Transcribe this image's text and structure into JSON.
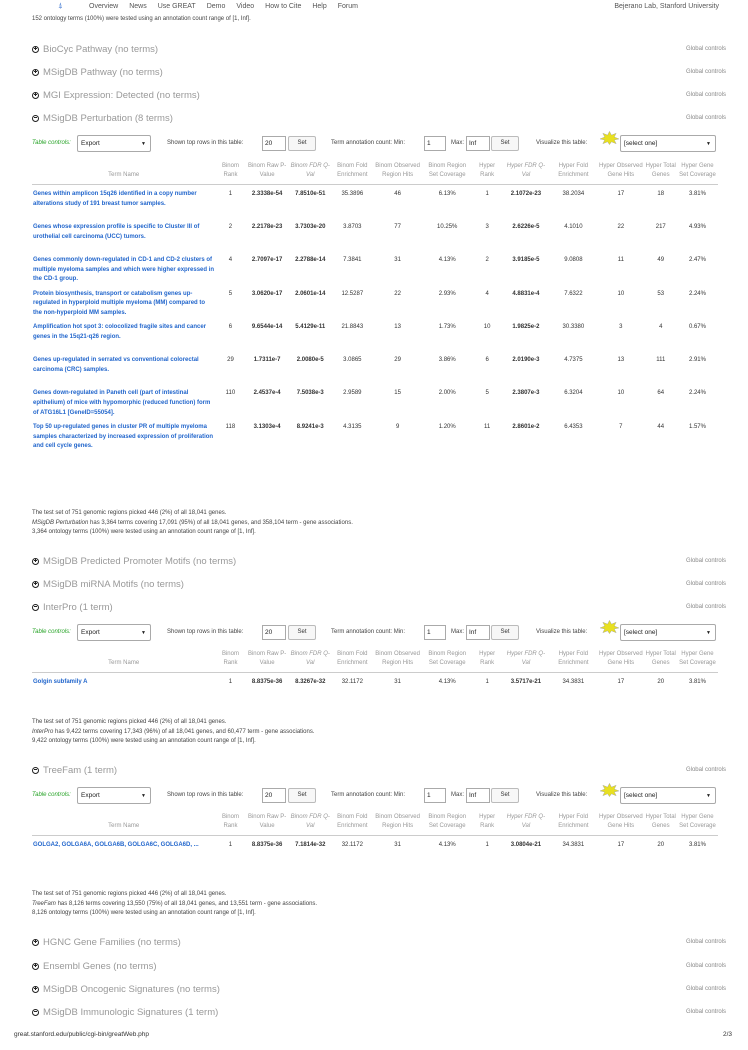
{
  "nav": {
    "logo": "⍋",
    "items": [
      "Overview",
      "News",
      "Use GREAT",
      "Demo",
      "Video",
      "How to Cite",
      "Help",
      "Forum"
    ],
    "lab": "Bejerano Lab, Stanford University"
  },
  "top_line": "152 ontology terms (100%) were tested using an annotation count range of [1, Inf].",
  "global_controls": "Global controls",
  "collapsed_sections": {
    "biocyc": "BioCyc Pathway (no terms)",
    "msigdb_pathway": "MSigDB Pathway (no terms)",
    "mgi": "MGI Expression: Detected (no terms)",
    "promoter": "MSigDB Predicted Promoter Motifs (no terms)",
    "mirna": "MSigDB miRNA Motifs (no terms)",
    "hgnc": "HGNC Gene Families (no terms)",
    "ensembl": "Ensembl Genes (no terms)",
    "oncogenic": "MSigDB Oncogenic Signatures (no terms)",
    "immunologic": "MSigDB Immunologic Signatures (1 term)"
  },
  "controls": {
    "table_controls": "Table controls:",
    "export": "Export",
    "shown_top": "Shown top rows in this table:",
    "top_value": "20",
    "set": "Set",
    "term_annot": "Term annotation count: Min:",
    "min_value": "1",
    "max": "Max:",
    "max_value": "Inf",
    "visualize": "Visualize this table:",
    "select_one": "[select one]"
  },
  "headers": {
    "term": "Term Name",
    "binom_rank": "Binom Rank",
    "binom_raw": "Binom Raw P-Value",
    "binom_fdr": "Binom FDR Q-Val",
    "binom_fold": "Binom Fold Enrichment",
    "binom_obs": "Binom Observed Region Hits",
    "binom_cov": "Binom Region Set Coverage",
    "hyper_rank": "Hyper Rank",
    "hyper_fdr": "Hyper FDR Q-Val",
    "hyper_fold": "Hyper Fold Enrichment",
    "hyper_obs": "Hyper Observed Gene Hits",
    "hyper_total": "Hyper Total Genes",
    "hyper_cov": "Hyper Gene Set Coverage"
  },
  "perturbation": {
    "title": "MSigDB Perturbation (8 terms)",
    "rows": [
      {
        "term": "Genes within amplicon 15q26 identified in a copy number alterations study of 191 breast tumor samples.",
        "binom_rank": "1",
        "raw_p": "2.3338e-54",
        "fdr": "7.8510e-51",
        "fold": "35.3896",
        "obs": "46",
        "cov": "6.13%",
        "h_rank": "1",
        "h_fdr": "2.1072e-23",
        "h_fold": "38.2034",
        "h_obs": "17",
        "h_total": "18",
        "h_cov": "3.81%"
      },
      {
        "term": "Genes whose expression profile is specific to Cluster III of urothelial cell carcinoma (UCC) tumors.",
        "binom_rank": "2",
        "raw_p": "2.2178e-23",
        "fdr": "3.7303e-20",
        "fold": "3.8703",
        "obs": "77",
        "cov": "10.25%",
        "h_rank": "3",
        "h_fdr": "2.6226e-5",
        "h_fold": "4.1010",
        "h_obs": "22",
        "h_total": "217",
        "h_cov": "4.93%"
      },
      {
        "term": "Genes commonly down-regulated in CD-1 and CD-2 clusters of multiple myeloma samples and which were higher expressed in the CD-1 group.",
        "binom_rank": "4",
        "raw_p": "2.7097e-17",
        "fdr": "2.2788e-14",
        "fold": "7.3841",
        "obs": "31",
        "cov": "4.13%",
        "h_rank": "2",
        "h_fdr": "3.9185e-5",
        "h_fold": "9.0808",
        "h_obs": "11",
        "h_total": "49",
        "h_cov": "2.47%"
      },
      {
        "term": "Protein biosynthesis, transport or catabolism genes up-regulated in hyperploid multiple myeloma (MM) compared to the non-hyperploid MM samples.",
        "binom_rank": "5",
        "raw_p": "3.0620e-17",
        "fdr": "2.0601e-14",
        "fold": "12.5287",
        "obs": "22",
        "cov": "2.93%",
        "h_rank": "4",
        "h_fdr": "4.8831e-4",
        "h_fold": "7.6322",
        "h_obs": "10",
        "h_total": "53",
        "h_cov": "2.24%"
      },
      {
        "term": "Amplification hot spot 3: colocolized fragile sites and cancer genes in the 15q21-q26 region.",
        "binom_rank": "6",
        "raw_p": "9.6544e-14",
        "fdr": "5.4129e-11",
        "fold": "21.8843",
        "obs": "13",
        "cov": "1.73%",
        "h_rank": "10",
        "h_fdr": "1.9825e-2",
        "h_fold": "30.3380",
        "h_obs": "3",
        "h_total": "4",
        "h_cov": "0.67%"
      },
      {
        "term": "Genes up-regulated in serrated vs conventional colorectal carcinoma (CRC) samples.",
        "binom_rank": "29",
        "raw_p": "1.7311e-7",
        "fdr": "2.0080e-5",
        "fold": "3.0865",
        "obs": "29",
        "cov": "3.86%",
        "h_rank": "6",
        "h_fdr": "2.0190e-3",
        "h_fold": "4.7375",
        "h_obs": "13",
        "h_total": "111",
        "h_cov": "2.91%"
      },
      {
        "term": "Genes down-regulated in Paneth cell (part of intestinal epithelium) of mice with hypomorphic (reduced function) form of ATG16L1 [GeneID=55054].",
        "binom_rank": "110",
        "raw_p": "2.4537e-4",
        "fdr": "7.5038e-3",
        "fold": "2.9589",
        "obs": "15",
        "cov": "2.00%",
        "h_rank": "5",
        "h_fdr": "2.3807e-3",
        "h_fold": "6.3204",
        "h_obs": "10",
        "h_total": "64",
        "h_cov": "2.24%"
      },
      {
        "term": "Top 50 up-regulated genes in cluster PR of multiple myeloma samples characterized by increased expression of proliferation and cell cycle genes.",
        "binom_rank": "118",
        "raw_p": "3.1303e-4",
        "fdr": "8.9241e-3",
        "fold": "4.3135",
        "obs": "9",
        "cov": "1.20%",
        "h_rank": "11",
        "h_fdr": "2.8601e-2",
        "h_fold": "6.4353",
        "h_obs": "7",
        "h_total": "44",
        "h_cov": "1.57%"
      }
    ],
    "summary_1": "The test set of 751 genomic regions picked 446 (2%) of all 18,041 genes.",
    "summary_2_name": "MSigDB Perturbation",
    "summary_2_rest": " has 3,364 terms covering 17,091 (95%) of all 18,041 genes, and 358,104 term - gene associations.",
    "summary_3": "3,364 ontology terms (100%) were tested using an annotation count range of [1, Inf]."
  },
  "interpro": {
    "title": "InterPro (1 term)",
    "rows": [
      {
        "term": "Golgin subfamily A",
        "binom_rank": "1",
        "raw_p": "8.8375e-36",
        "fdr": "8.3267e-32",
        "fold": "32.1172",
        "obs": "31",
        "cov": "4.13%",
        "h_rank": "1",
        "h_fdr": "3.5717e-21",
        "h_fold": "34.3831",
        "h_obs": "17",
        "h_total": "20",
        "h_cov": "3.81%"
      }
    ],
    "summary_1": "The test set of 751 genomic regions picked 446 (2%) of all 18,041 genes.",
    "summary_2_name": "InterPro",
    "summary_2_rest": " has 9,422 terms covering 17,343 (96%) of all 18,041 genes, and 60,477 term - gene associations.",
    "summary_3": "9,422 ontology terms (100%) were tested using an annotation count range of [1, Inf]."
  },
  "treefam": {
    "title": "TreeFam (1 term)",
    "rows": [
      {
        "term": "GOLGA2, GOLGA6A, GOLGA6B, GOLGA6C, GOLGA6D, ...",
        "binom_rank": "1",
        "raw_p": "8.8375e-36",
        "fdr": "7.1814e-32",
        "fold": "32.1172",
        "obs": "31",
        "cov": "4.13%",
        "h_rank": "1",
        "h_fdr": "3.0804e-21",
        "h_fold": "34.3831",
        "h_obs": "17",
        "h_total": "20",
        "h_cov": "3.81%"
      }
    ],
    "summary_1": "The test set of 751 genomic regions picked 446 (2%) of all 18,041 genes.",
    "summary_2_name": "TreeFam",
    "summary_2_rest": " has 8,126 terms covering 13,550 (75%) of all 18,041 genes, and 13,551 term - gene associations.",
    "summary_3": "8,126 ontology terms (100%) were tested using an annotation count range of [1, Inf]."
  },
  "footer": {
    "url": "great.stanford.edu/public/cgi-bin/greatWeb.php",
    "page": "2/3"
  }
}
